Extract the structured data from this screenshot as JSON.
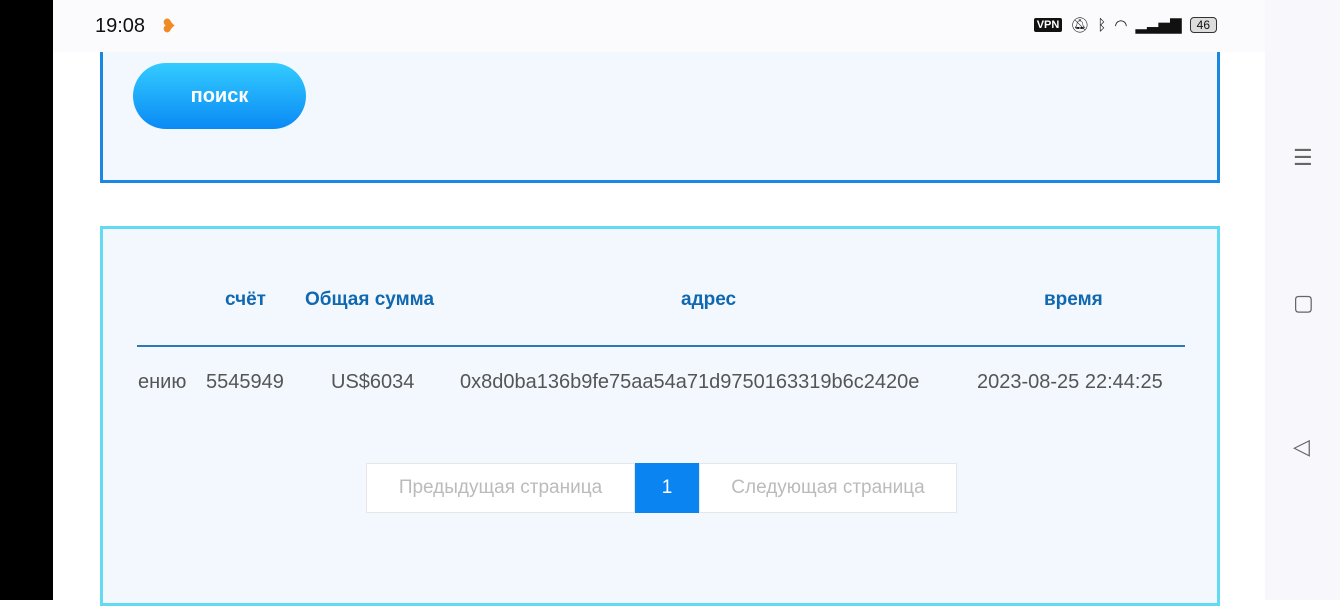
{
  "status_bar": {
    "time": "19:08",
    "vpn": "VPN",
    "battery": "46"
  },
  "search": {
    "button_label": "поиск"
  },
  "table": {
    "headers": [
      "счёт",
      "Общая сумма",
      "адрес",
      "время"
    ],
    "rows": [
      {
        "prefix": "ению",
        "account": "5545949",
        "total": "US$6034",
        "address": "0x8d0ba136b9fe75aa54a71d9750163319b6c2420e",
        "time": "2023-08-25 22:44:25"
      }
    ]
  },
  "pagination": {
    "prev": "Предыдущая страница",
    "current": "1",
    "next": "Следующая страница"
  }
}
